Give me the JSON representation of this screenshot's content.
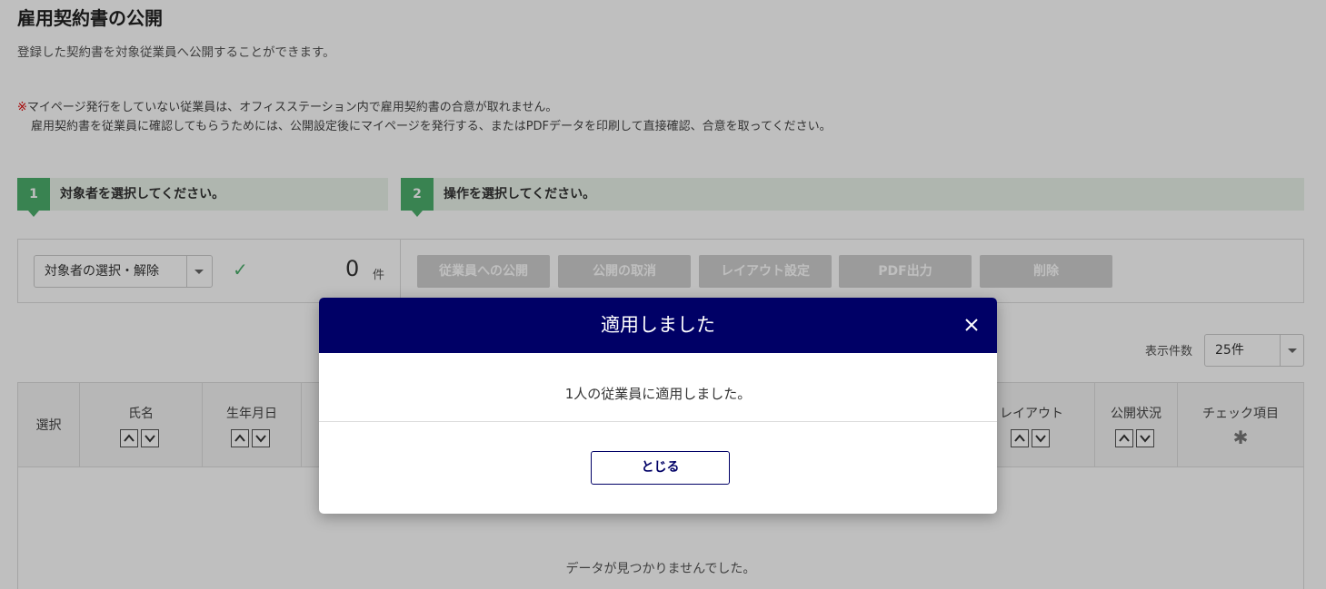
{
  "page": {
    "title": "雇用契約書の公開",
    "description": "登録した契約書を対象従業員へ公開することができます。",
    "notice_mark": "※",
    "notice_line1": "マイページ発行をしていない従業員は、オフィスステーション内で雇用契約書の合意が取れません。",
    "notice_line2": "雇用契約書を従業員に確認してもらうためには、公開設定後にマイページを発行する、またはPDFデータを印刷して直接確認、合意を取ってください。"
  },
  "steps": [
    {
      "number": "1",
      "label": "対象者を選択してください。"
    },
    {
      "number": "2",
      "label": "操作を選択してください。"
    }
  ],
  "toolbar": {
    "select_label": "対象者の選択・解除",
    "count": "0",
    "count_unit": "件",
    "actions": [
      "従業員への公開",
      "公開の取消",
      "レイアウト設定",
      "PDF出力",
      "削除"
    ]
  },
  "perpage": {
    "label": "表示件数",
    "value": "25件"
  },
  "table": {
    "columns": [
      "選択",
      "氏名",
      "生年月日",
      "レイアウト",
      "公開状況",
      "チェック項目"
    ],
    "empty_message": "データが見つかりませんでした。"
  },
  "modal": {
    "title": "適用しました",
    "message": "1人の従業員に適用しました。",
    "close_button": "とじる"
  },
  "colors": {
    "step_green": "#4caf6d",
    "modal_header": "#000066",
    "disabled_button": "#cfcfcf",
    "notice_mark": "#dd0000"
  },
  "icons": {
    "check": "check-icon",
    "close": "close-icon",
    "gear": "gear-icon",
    "sort_up": "sort-up-icon",
    "sort_down": "sort-down-icon",
    "caret": "caret-down-icon"
  }
}
